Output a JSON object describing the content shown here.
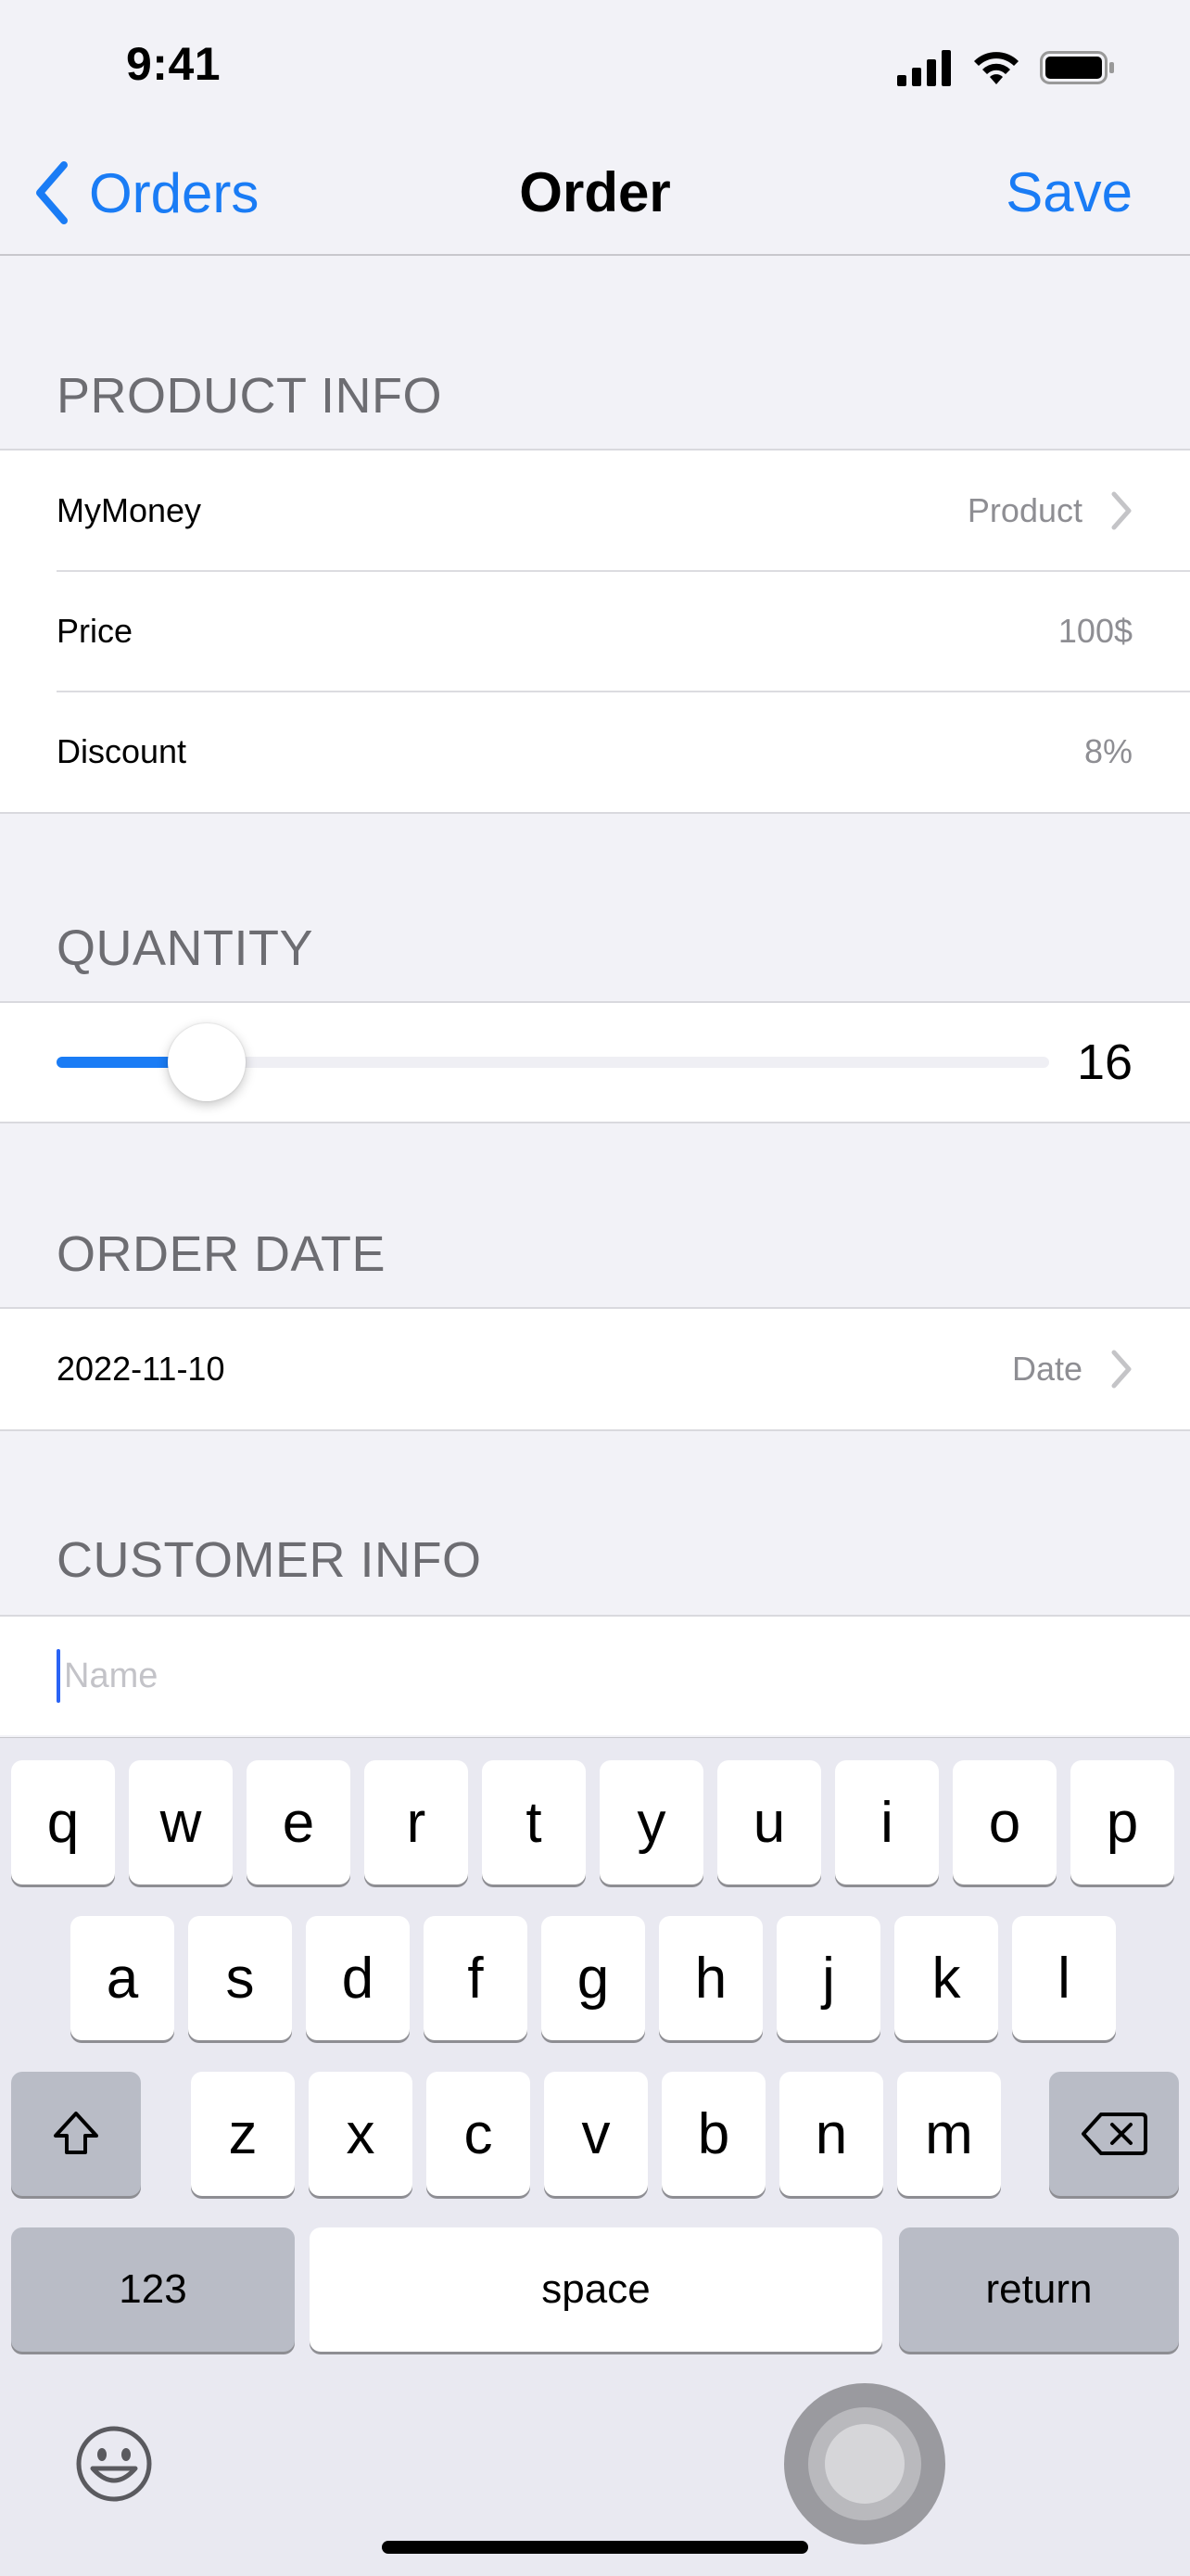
{
  "status_bar": {
    "time": "9:41"
  },
  "nav": {
    "back_label": "Orders",
    "title": "Order",
    "save_label": "Save"
  },
  "product_info": {
    "header": "PRODUCT INFO",
    "rows": [
      {
        "label": "MyMoney",
        "value": "Product"
      },
      {
        "label": "Price",
        "value": "100$"
      },
      {
        "label": "Discount",
        "value": "8%"
      }
    ]
  },
  "quantity": {
    "header": "QUANTITY",
    "value": "16",
    "slider_fraction": 0.15
  },
  "order_date": {
    "header": "ORDER DATE",
    "date": "2022-11-10",
    "value": "Date"
  },
  "customer_info": {
    "header": "CUSTOMER INFO",
    "name_placeholder": "Name",
    "name_value": ""
  },
  "keyboard": {
    "row1": [
      "q",
      "w",
      "e",
      "r",
      "t",
      "y",
      "u",
      "i",
      "o",
      "p"
    ],
    "row2": [
      "a",
      "s",
      "d",
      "f",
      "g",
      "h",
      "j",
      "k",
      "l"
    ],
    "row3": [
      "z",
      "x",
      "c",
      "v",
      "b",
      "n",
      "m"
    ],
    "numbers_label": "123",
    "space_label": "space",
    "return_label": "return"
  },
  "colors": {
    "accent": "#1a7cf5",
    "background": "#f2f2f7",
    "secondary_text": "#8e8e93"
  }
}
